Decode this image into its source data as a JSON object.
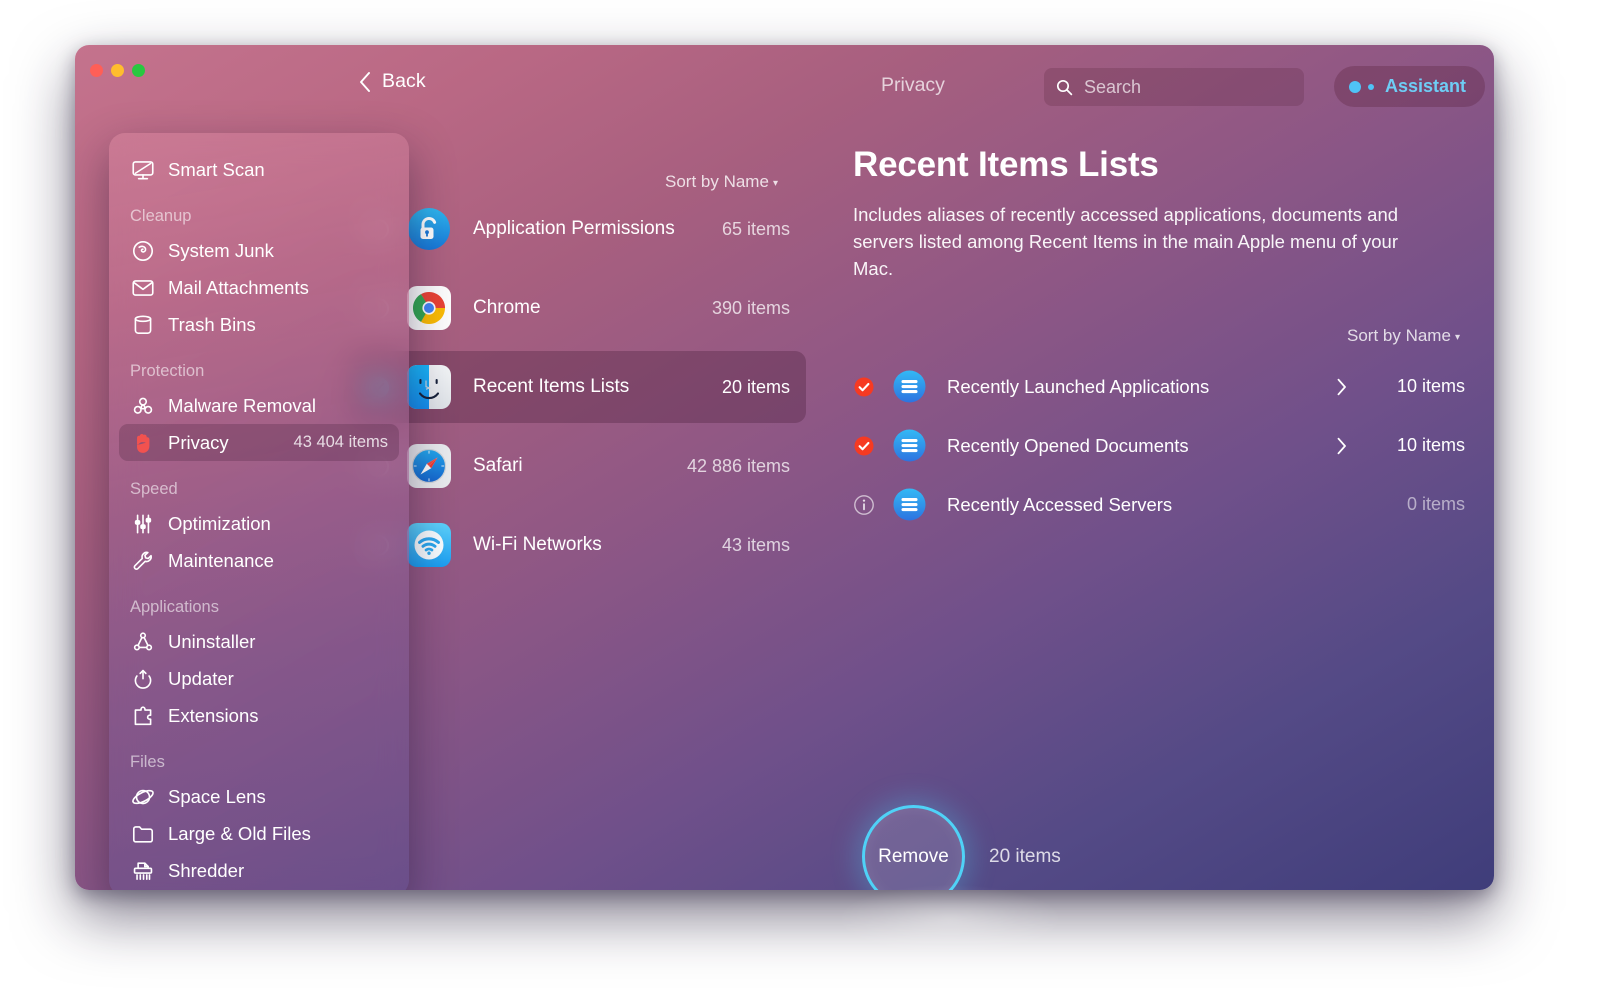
{
  "window": {
    "traffic_lights": [
      "close",
      "minimize",
      "zoom"
    ]
  },
  "toolbar": {
    "back_label": "Back",
    "breadcrumb": "Privacy",
    "search_placeholder": "Search",
    "assistant_label": "Assistant",
    "assistant_color": "#6ecdf5"
  },
  "sidebar": {
    "top_item": {
      "label": "Smart Scan",
      "icon": "monitor-scan-icon"
    },
    "groups": [
      {
        "title": "Cleanup",
        "items": [
          {
            "label": "System Junk",
            "icon": "junk-icon"
          },
          {
            "label": "Mail Attachments",
            "icon": "mail-icon"
          },
          {
            "label": "Trash Bins",
            "icon": "trash-icon"
          }
        ]
      },
      {
        "title": "Protection",
        "items": [
          {
            "label": "Malware Removal",
            "icon": "biohazard-icon"
          },
          {
            "label": "Privacy",
            "icon": "hand-icon",
            "count": "43 404 items",
            "active": true
          }
        ]
      },
      {
        "title": "Speed",
        "items": [
          {
            "label": "Optimization",
            "icon": "sliders-icon"
          },
          {
            "label": "Maintenance",
            "icon": "wrench-icon"
          }
        ]
      },
      {
        "title": "Applications",
        "items": [
          {
            "label": "Uninstaller",
            "icon": "uninstaller-icon"
          },
          {
            "label": "Updater",
            "icon": "updater-icon"
          },
          {
            "label": "Extensions",
            "icon": "puzzle-icon"
          }
        ]
      },
      {
        "title": "Files",
        "items": [
          {
            "label": "Space Lens",
            "icon": "space-lens-icon"
          },
          {
            "label": "Large & Old Files",
            "icon": "folder-icon"
          },
          {
            "label": "Shredder",
            "icon": "shredder-icon"
          }
        ]
      }
    ]
  },
  "middle": {
    "sort_label": "Sort by Name",
    "items": [
      {
        "label": "Application Permissions",
        "count": "65 items",
        "icon": "lock-open-icon",
        "checked": false
      },
      {
        "label": "Chrome",
        "count": "390 items",
        "icon": "chrome-icon",
        "checked": false
      },
      {
        "label": "Recent Items Lists",
        "count": "20 items",
        "icon": "finder-icon",
        "checked": true,
        "selected": true
      },
      {
        "label": "Safari",
        "count": "42 886 items",
        "icon": "safari-icon",
        "checked": false
      },
      {
        "label": "Wi-Fi Networks",
        "count": "43 items",
        "icon": "wifi-icon",
        "checked": false
      }
    ]
  },
  "detail": {
    "title": "Recent Items Lists",
    "description": "Includes aliases of recently accessed applications, documents and servers listed among Recent Items in the main Apple menu of your Mac.",
    "sort_label": "Sort by Name",
    "items": [
      {
        "label": "Recently Launched Applications",
        "count": "10 items",
        "state": "checked",
        "icon": "list-icon",
        "chevron": true
      },
      {
        "label": "Recently Opened Documents",
        "count": "10 items",
        "state": "checked",
        "icon": "list-icon",
        "chevron": true
      },
      {
        "label": "Recently Accessed Servers",
        "count": "0 items",
        "state": "info",
        "icon": "list-icon",
        "chevron": false
      }
    ]
  },
  "footer": {
    "remove_label": "Remove",
    "remove_count": "20 items",
    "accent_color": "#4fd2f7"
  }
}
